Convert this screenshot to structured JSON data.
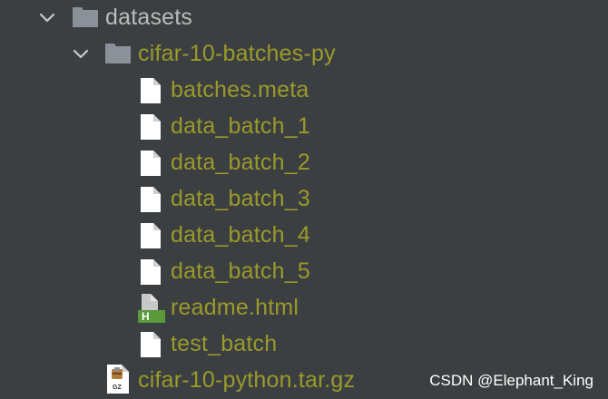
{
  "colors": {
    "background": "#3c3f41",
    "folder_text": "#bbbbbb",
    "file_text": "#999a2a",
    "folder_icon": "#8a9199",
    "file_icon": "#ffffff",
    "html_badge": "#5a9a3a"
  },
  "tree": {
    "root": {
      "label": "datasets",
      "expanded": true,
      "icon": "folder-icon"
    },
    "subfolder": {
      "label": "cifar-10-batches-py",
      "expanded": true,
      "icon": "folder-icon"
    },
    "files": [
      {
        "label": "batches.meta",
        "icon": "file-icon"
      },
      {
        "label": "data_batch_1",
        "icon": "file-icon"
      },
      {
        "label": "data_batch_2",
        "icon": "file-icon"
      },
      {
        "label": "data_batch_3",
        "icon": "file-icon"
      },
      {
        "label": "data_batch_4",
        "icon": "file-icon"
      },
      {
        "label": "data_batch_5",
        "icon": "file-icon"
      },
      {
        "label": "readme.html",
        "icon": "html-file-icon",
        "badge": "H"
      },
      {
        "label": "test_batch",
        "icon": "file-icon"
      }
    ],
    "archive": {
      "label": "cifar-10-python.tar.gz",
      "icon": "archive-icon",
      "badge": "GZ"
    }
  },
  "watermark": "CSDN @Elephant_King"
}
